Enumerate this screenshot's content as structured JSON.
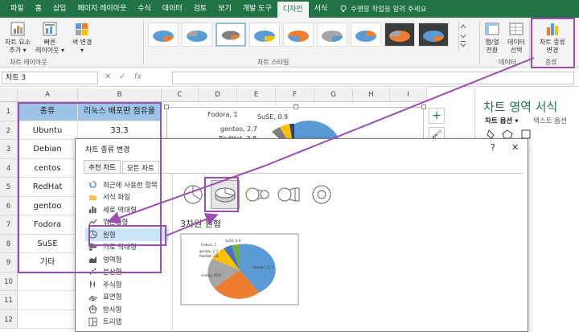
{
  "ribbon": {
    "tabs": [
      "파일",
      "홈",
      "삽입",
      "페이지 레이아웃",
      "수식",
      "데이터",
      "검토",
      "보기",
      "개발 도구",
      "디자인",
      "서식"
    ],
    "active_tab": "디자인",
    "tellme": "수행할 작업을 알려 주세요",
    "buttons": {
      "add_element": "차트 요소\n추가 ▾",
      "quick_layout": "빠른\n레이아웃 ▾",
      "change_colors": "색 변경\n▾",
      "switch_row_col": "행/열\n전환",
      "select_data": "데이터\n선택",
      "change_type": "차트 종류\n변경"
    },
    "groups": {
      "layout": "차트 레이아웃",
      "styles": "차트 스타일",
      "data": "데이터",
      "type": "종류"
    }
  },
  "formula_bar": {
    "name_box": "차트 3",
    "cancel": "✕",
    "enter": "✓",
    "fx": "fx"
  },
  "sheet": {
    "columns": [
      "A",
      "B",
      "C",
      "D",
      "E",
      "F",
      "G",
      "H",
      "I"
    ],
    "rows": [
      "1",
      "2",
      "3",
      "4",
      "5",
      "6",
      "7",
      "8",
      "9",
      "10",
      "11",
      "12"
    ],
    "header": [
      "종류",
      "리눅스 배포판 점유율"
    ],
    "data": [
      [
        "Ubuntu",
        "33.3"
      ],
      [
        "Debian",
        ""
      ],
      [
        "centos",
        ""
      ],
      [
        "RedHat",
        ""
      ],
      [
        "gentoo",
        ""
      ],
      [
        "Fodora",
        ""
      ],
      [
        "SuSE",
        ""
      ],
      [
        "기타",
        ""
      ]
    ]
  },
  "chart": {
    "labels": {
      "fodora": "Fodora, 1",
      "suse": "SuSE, 0.9",
      "gentoo": "gentoo, 2.7",
      "redhat": "RedHat, 3.8"
    }
  },
  "side_buttons": {
    "plus": "+",
    "brush": "🖌"
  },
  "pane": {
    "title": "차트 영역 서식",
    "tab1": "차트 옵션 ▾",
    "tab2": "텍스트 옵션"
  },
  "dialog": {
    "title": "차트 종류 변경",
    "help": "?",
    "close": "✕",
    "tabs": [
      "추천 차트",
      "모든 차트"
    ],
    "categories": [
      {
        "label": "최근에 사용한 항목",
        "icon": "recent-icon"
      },
      {
        "label": "서식 파일",
        "icon": "folder-icon"
      },
      {
        "label": "세로 막대형",
        "icon": "column-chart-icon"
      },
      {
        "label": "꺾은선형",
        "icon": "line-chart-icon"
      },
      {
        "label": "원형",
        "icon": "pie-chart-icon"
      },
      {
        "label": "가로 막대형",
        "icon": "bar-chart-icon"
      },
      {
        "label": "영역형",
        "icon": "area-chart-icon"
      },
      {
        "label": "분산형",
        "icon": "scatter-chart-icon"
      },
      {
        "label": "주식형",
        "icon": "stock-chart-icon"
      },
      {
        "label": "표면형",
        "icon": "surface-chart-icon"
      },
      {
        "label": "방사형",
        "icon": "radar-chart-icon"
      },
      {
        "label": "트리맵",
        "icon": "treemap-chart-icon"
      }
    ],
    "selected_category": "원형",
    "preview_title": "3차원 원형",
    "preview_labels": [
      "SuSE, 0.9",
      "Fodora, 1",
      "gentoo, 2.7",
      "RedHat, 3.8",
      "centos, 20.0",
      "Ubuntu, 33.3"
    ]
  },
  "colors": {
    "excel_green": "#217346",
    "header_fill": "#9dc3e6",
    "highlight": "#9b4db0",
    "pie_blue": "#5b9bd5",
    "pie_orange": "#ed7d31",
    "pie_gray": "#a5a5a5",
    "pie_yellow": "#ffc000"
  }
}
